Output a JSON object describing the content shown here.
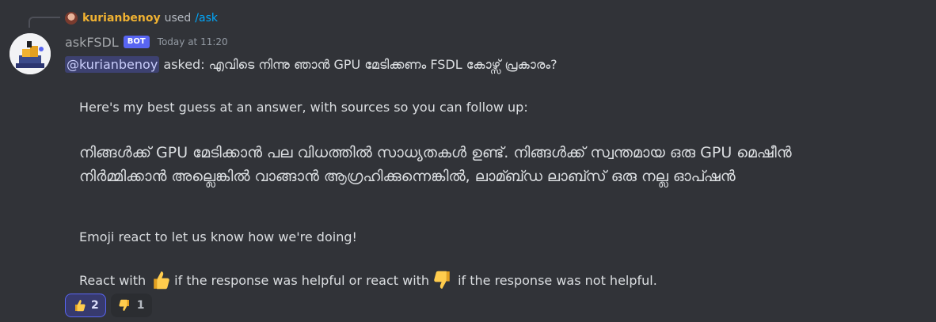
{
  "reply": {
    "user": "kurianbenoy",
    "used": "used",
    "command": "/ask"
  },
  "message": {
    "username": "askFSDL",
    "bot_tag": "BOT",
    "timestamp": "Today at 11:20",
    "mention": "@kurianbenoy",
    "asked": " asked: എവിടെ നിന്നു ഞാൻ GPU മേടിക്കണം FSDL കോഴ്സ് പ്രകാരം?",
    "guess": "Here's my best guess at an answer, with sources so you can follow up:",
    "answer": "നിങ്ങൾക്ക് GPU മേടിക്കാൻ പല വിധത്തിൽ സാധ്യതകൾ ഉണ്ട്. നിങ്ങൾക്ക് സ്വന്തമായ ഒരു GPU മെഷീൻ നിർമ്മിക്കാൻ അല്ലെങ്കിൽ വാങ്ങാൻ ആഗ്രഹിക്കുന്നെങ്കിൽ, ലാമ്ബ്ഡ ലാബ്സ് ഒരു നല്ല ഓപ്ഷൻ",
    "emoji_prompt": "Emoji react to let us know how we're doing!",
    "react_with": "React with",
    "helpful_text": "if the response was helpful or react with",
    "not_helpful_text": "if the response was not helpful."
  },
  "reactions": [
    {
      "emoji": "thumbs-up-icon",
      "count": "2",
      "active": true
    },
    {
      "emoji": "thumbs-down-icon",
      "count": "1",
      "active": false
    }
  ],
  "colors": {
    "background": "#313338",
    "mention_bg": "#3c4270",
    "bot_tag": "#5865f2",
    "reply_user": "#f0b232",
    "command": "#00a8fc",
    "emoji_yellow": "#ffcc4d"
  }
}
